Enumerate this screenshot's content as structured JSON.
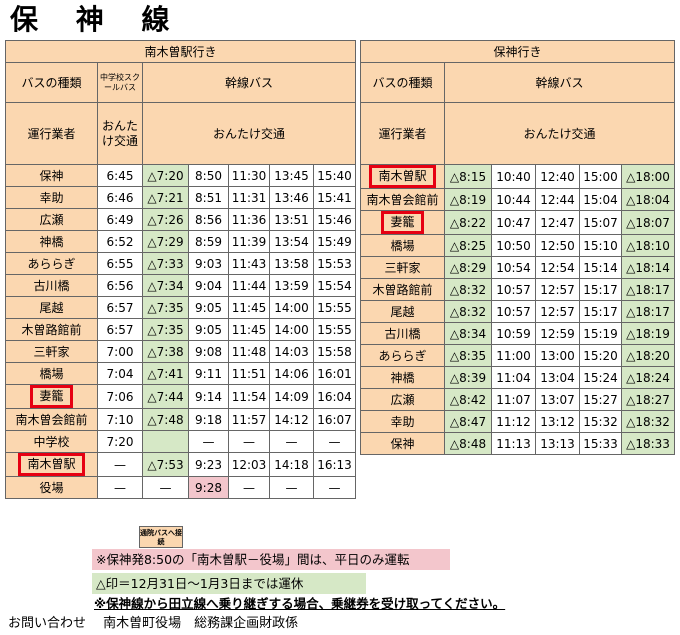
{
  "title": "保 神 線",
  "left": {
    "direction": "南木曽駅行き",
    "type_label": "バスの種類",
    "school_bus": "中学校スクールバス",
    "trunk_bus": "幹線バス",
    "operator_label": "運行業者",
    "school_operator": "おんたけ交通",
    "trunk_operator": "おんたけ交通",
    "rows": [
      {
        "stop": "保神",
        "s": "6:45",
        "t": [
          "△7:20",
          "8:50",
          "11:30",
          "13:45",
          "15:40"
        ]
      },
      {
        "stop": "幸助",
        "s": "6:46",
        "t": [
          "△7:21",
          "8:51",
          "11:31",
          "13:46",
          "15:41"
        ]
      },
      {
        "stop": "広瀬",
        "s": "6:49",
        "t": [
          "△7:26",
          "8:56",
          "11:36",
          "13:51",
          "15:46"
        ]
      },
      {
        "stop": "神橋",
        "s": "6:52",
        "t": [
          "△7:29",
          "8:59",
          "11:39",
          "13:54",
          "15:49"
        ]
      },
      {
        "stop": "あららぎ",
        "s": "6:55",
        "t": [
          "△7:33",
          "9:03",
          "11:43",
          "13:58",
          "15:53"
        ]
      },
      {
        "stop": "古川橋",
        "s": "6:56",
        "t": [
          "△7:34",
          "9:04",
          "11:44",
          "13:59",
          "15:54"
        ]
      },
      {
        "stop": "尾越",
        "s": "6:57",
        "t": [
          "△7:35",
          "9:05",
          "11:45",
          "14:00",
          "15:55"
        ]
      },
      {
        "stop": "木曽路館前",
        "s": "6:57",
        "t": [
          "△7:35",
          "9:05",
          "11:45",
          "14:00",
          "15:55"
        ]
      },
      {
        "stop": "三軒家",
        "s": "7:00",
        "t": [
          "△7:38",
          "9:08",
          "11:48",
          "14:03",
          "15:58"
        ]
      },
      {
        "stop": "橋場",
        "s": "7:04",
        "t": [
          "△7:41",
          "9:11",
          "11:51",
          "14:06",
          "16:01"
        ]
      },
      {
        "stop": "妻籠",
        "s": "7:06",
        "t": [
          "△7:44",
          "9:14",
          "11:54",
          "14:09",
          "16:04"
        ]
      },
      {
        "stop": "南木曽会館前",
        "s": "7:10",
        "t": [
          "△7:48",
          "9:18",
          "11:57",
          "14:12",
          "16:07"
        ]
      },
      {
        "stop": "中学校",
        "s": "7:20",
        "t": [
          "",
          "—",
          "—",
          "—",
          "—"
        ]
      },
      {
        "stop": "南木曽駅",
        "s": "—",
        "t": [
          "△7:53",
          "9:23",
          "12:03",
          "14:18",
          "16:13"
        ]
      },
      {
        "stop": "役場",
        "s": "—",
        "t": [
          "—",
          "9:28",
          "—",
          "—",
          "—"
        ]
      }
    ],
    "transfer_note": "通院バスへ接続"
  },
  "right": {
    "direction": "保神行き",
    "type_label": "バスの種類",
    "trunk_bus": "幹線バス",
    "operator_label": "運行業者",
    "trunk_operator": "おんたけ交通",
    "rows": [
      {
        "stop": "南木曽駅",
        "t": [
          "△8:15",
          "10:40",
          "12:40",
          "15:00",
          "△18:00"
        ]
      },
      {
        "stop": "南木曽会館前",
        "t": [
          "△8:19",
          "10:44",
          "12:44",
          "15:04",
          "△18:04"
        ]
      },
      {
        "stop": "妻籠",
        "t": [
          "△8:22",
          "10:47",
          "12:47",
          "15:07",
          "△18:07"
        ]
      },
      {
        "stop": "橋場",
        "t": [
          "△8:25",
          "10:50",
          "12:50",
          "15:10",
          "△18:10"
        ]
      },
      {
        "stop": "三軒家",
        "t": [
          "△8:29",
          "10:54",
          "12:54",
          "15:14",
          "△18:14"
        ]
      },
      {
        "stop": "木曽路館前",
        "t": [
          "△8:32",
          "10:57",
          "12:57",
          "15:17",
          "△18:17"
        ]
      },
      {
        "stop": "尾越",
        "t": [
          "△8:32",
          "10:57",
          "12:57",
          "15:17",
          "△18:17"
        ]
      },
      {
        "stop": "古川橋",
        "t": [
          "△8:34",
          "10:59",
          "12:59",
          "15:19",
          "△18:19"
        ]
      },
      {
        "stop": "あららぎ",
        "t": [
          "△8:35",
          "11:00",
          "13:00",
          "15:20",
          "△18:20"
        ]
      },
      {
        "stop": "神橋",
        "t": [
          "△8:39",
          "11:04",
          "13:04",
          "15:24",
          "△18:24"
        ]
      },
      {
        "stop": "広瀬",
        "t": [
          "△8:42",
          "11:07",
          "13:07",
          "15:27",
          "△18:27"
        ]
      },
      {
        "stop": "幸助",
        "t": [
          "△8:47",
          "11:12",
          "13:12",
          "15:32",
          "△18:32"
        ]
      },
      {
        "stop": "保神",
        "t": [
          "△8:48",
          "11:13",
          "13:13",
          "15:33",
          "△18:33"
        ]
      }
    ]
  },
  "notes": {
    "note1": "※保神発8:50の「南木曽駅－役場」間は、平日のみ運転",
    "note2": "△印＝12月31日～1月3日までは運休",
    "note3": "※保神線から田立線へ乗り継ぎする場合、乗継券を受け取ってください。",
    "contact": "お問い合わせ　 南木曽町役場　総務課企画財政係"
  },
  "colors": {
    "header": "#fbd7b0",
    "green": "#d6e8c6",
    "pink": "#f3c6cc",
    "red_box": "#e60012"
  }
}
